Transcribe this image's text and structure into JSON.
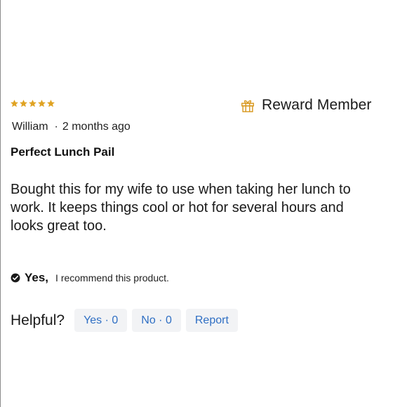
{
  "review": {
    "rating": 5,
    "rating_max": 5,
    "star_color": "#e0a323",
    "badge": {
      "icon": "gift-icon",
      "label": "Reward Member"
    },
    "author": "William",
    "separator": "·",
    "time_ago": "2 months ago",
    "title": "Perfect Lunch Pail",
    "body": "Bought this for my wife to use when taking her lunch to work. It keeps things cool or hot for several hours and looks great too.",
    "recommendation": {
      "icon": "check-circle-icon",
      "answer": "Yes,",
      "text": "I recommend this product."
    },
    "helpful": {
      "label": "Helpful?",
      "yes_button": "Yes · 0",
      "no_button": "No · 0",
      "report_button": "Report"
    }
  },
  "colors": {
    "link_blue": "#2f6fc4",
    "button_bg": "#f2f3f5"
  }
}
